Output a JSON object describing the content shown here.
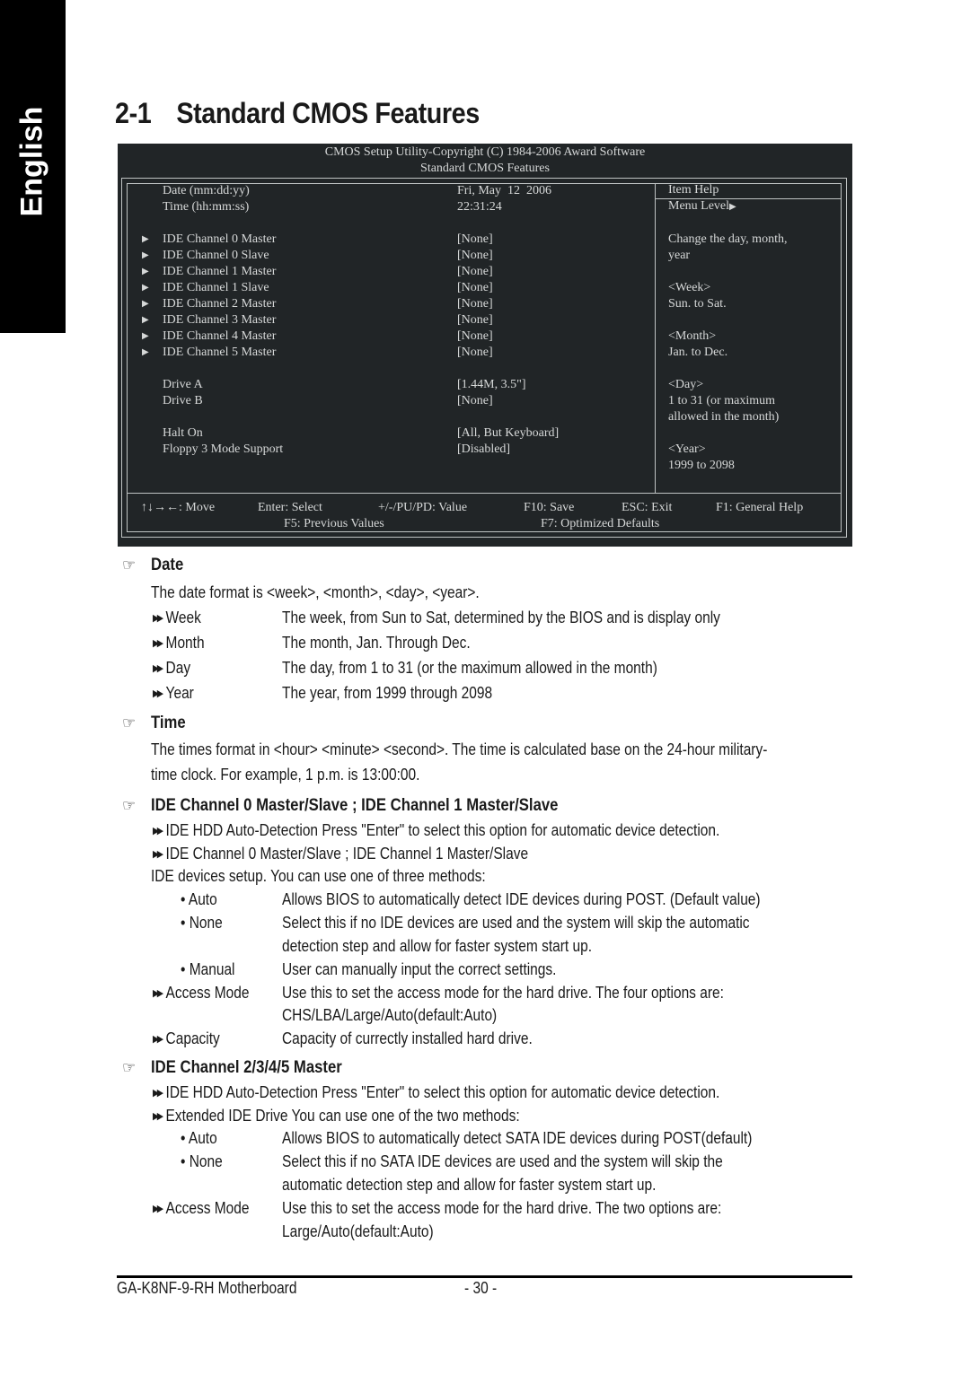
{
  "side_tab": {
    "label": "English"
  },
  "section": {
    "number": "2-1",
    "title": "Standard CMOS Features"
  },
  "bios": {
    "header_line1": "CMOS Setup Utility-Copyright (C) 1984-2006 Award Software",
    "header_line2": "Standard CMOS Features",
    "items": [
      {
        "label": "Date (mm:dd:yy)",
        "value": "Fri, May  12  2006",
        "submenu": false
      },
      {
        "label": "Time (hh:mm:ss)",
        "value": "22:31:24",
        "submenu": false
      },
      {
        "label": "IDE Channel 0 Master",
        "value": "[None]",
        "submenu": true
      },
      {
        "label": "IDE Channel 0 Slave",
        "value": "[None]",
        "submenu": true
      },
      {
        "label": "IDE Channel 1 Master",
        "value": "[None]",
        "submenu": true
      },
      {
        "label": "IDE Channel 1 Slave",
        "value": "[None]",
        "submenu": true
      },
      {
        "label": "IDE Channel 2 Master",
        "value": "[None]",
        "submenu": true
      },
      {
        "label": "IDE Channel 3 Master",
        "value": "[None]",
        "submenu": true
      },
      {
        "label": "IDE Channel 4 Master",
        "value": "[None]",
        "submenu": true
      },
      {
        "label": "IDE Channel 5 Master",
        "value": "[None]",
        "submenu": true
      },
      {
        "label": "Drive A",
        "value": "[1.44M, 3.5\"]",
        "submenu": false
      },
      {
        "label": "Drive B",
        "value": "[None]",
        "submenu": false
      },
      {
        "label": "Halt On",
        "value": "[All, But Keyboard]",
        "submenu": false
      },
      {
        "label": "Floppy 3 Mode Support",
        "value": "[Disabled]",
        "submenu": false
      }
    ],
    "submenu_arrow": "▶",
    "help": {
      "title": "Item Help",
      "menu_level": "Menu Level",
      "menu_level_arrow": "▶",
      "lines": [
        "Change the day, month,",
        "year",
        "",
        "<Week>",
        "Sun. to Sat.",
        "",
        "<Month>",
        "Jan. to Dec.",
        "",
        "<Day>",
        "1 to 31 (or maximum",
        "allowed in the month)",
        "",
        "<Year>",
        "1999 to 2098"
      ]
    },
    "keys_row1": [
      {
        "key": "↑↓→←: Move"
      },
      {
        "key": "Enter: Select"
      },
      {
        "key": "+/-/PU/PD: Value"
      },
      {
        "key": "F10: Save"
      },
      {
        "key": "ESC: Exit"
      },
      {
        "key": "F1: General Help"
      }
    ],
    "keys_row2": [
      {
        "key": "F5: Previous Values"
      },
      {
        "key": "F7: Optimized Defaults"
      }
    ]
  },
  "date_section": {
    "heading": "Date",
    "intro": "The date format is <week>, <month>, <day>, <year>.",
    "items": [
      {
        "term": "Week",
        "desc": "The week, from Sun to Sat, determined by the BIOS and is display only"
      },
      {
        "term": "Month",
        "desc": "The month, Jan. Through Dec."
      },
      {
        "term": "Day",
        "desc": "The day, from 1 to 31 (or the maximum allowed in the month)"
      },
      {
        "term": "Year",
        "desc": "The year, from 1999 through 2098"
      }
    ]
  },
  "time_section": {
    "heading": "Time",
    "line1": "The times format in <hour> <minute> <second>. The time is calculated base on the 24-hour military-",
    "line2": "time clock. For example, 1 p.m. is 13:00:00."
  },
  "ide01_section": {
    "heading": "IDE Channel 0 Master/Slave ; IDE Channel 1 Master/Slave",
    "bullet1": "IDE HDD Auto-Detection  Press \"Enter\" to select this option for automatic device detection.",
    "bullet2": "IDE Channel 0 Master/Slave ; IDE Channel 1 Master/Slave",
    "intro": "IDE devices setup.  You can use one of three methods:",
    "methods": [
      {
        "term": "Auto",
        "lines": [
          "Allows BIOS to automatically detect IDE devices during POST. (Default value)"
        ]
      },
      {
        "term": "None",
        "lines": [
          "Select this if no IDE devices are used and the system will skip the automatic",
          "detection step and allow for faster system start up."
        ]
      },
      {
        "term": "Manual",
        "lines": [
          "User can manually input the correct settings."
        ]
      }
    ],
    "access_mode": {
      "term": "Access Mode",
      "lines": [
        "Use this to set the access mode for the hard drive. The four options are:",
        "CHS/LBA/Large/Auto(default:Auto)"
      ]
    },
    "capacity": {
      "term": "Capacity",
      "lines": [
        "Capacity of currectly installed hard drive."
      ]
    }
  },
  "ide2345_section": {
    "heading": "IDE Channel 2/3/4/5 Master",
    "bullet1": "IDE HDD Auto-Detection  Press \"Enter\" to select this option for automatic device detection.",
    "bullet2": "Extended IDE Drive  You can use one of the two methods:",
    "methods": [
      {
        "term": "Auto",
        "lines": [
          "Allows BIOS to automatically detect SATA IDE devices during POST(default)"
        ]
      },
      {
        "term": "None",
        "lines": [
          "Select this if no SATA IDE devices are used and the system will skip the",
          "automatic detection step and allow for faster system start up."
        ]
      }
    ],
    "access_mode": {
      "term": "Access Mode",
      "lines": [
        "Use this to set the access mode for the hard drive. The two options are:",
        "Large/Auto(default:Auto)"
      ]
    }
  },
  "footer": {
    "model": "GA-K8NF-9-RH Motherboard",
    "page": "- 30 -"
  }
}
